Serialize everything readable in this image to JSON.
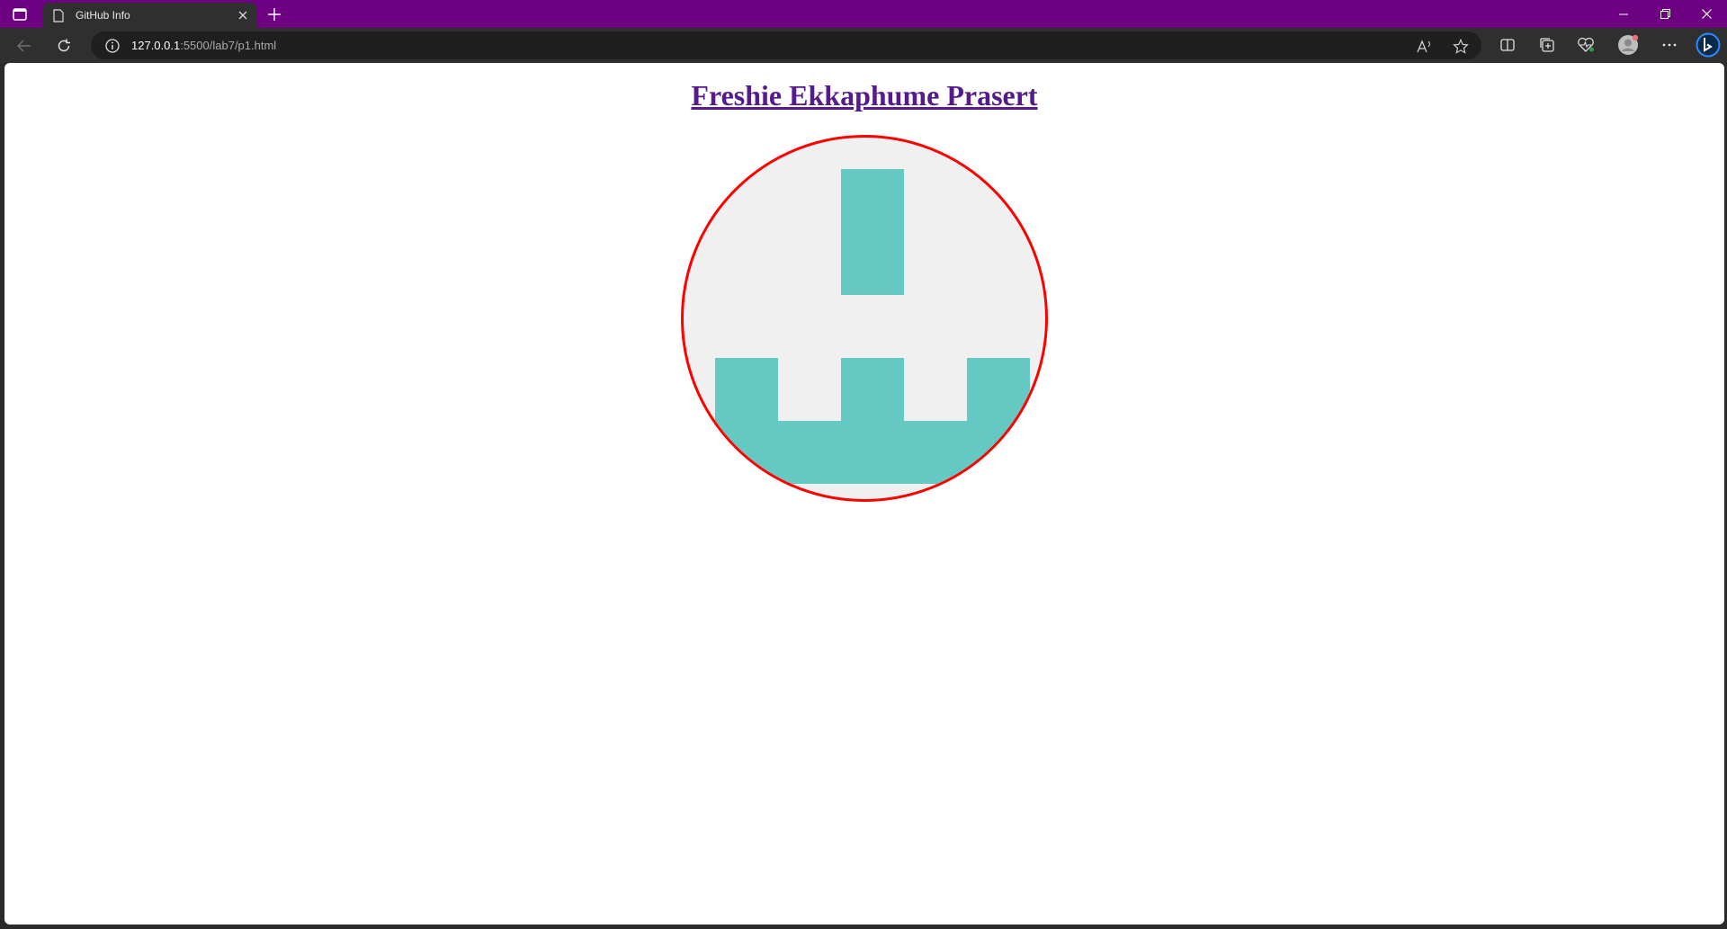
{
  "browser": {
    "tab": {
      "title": "GitHub Info"
    },
    "address": {
      "host": "127.0.0.1",
      "path": ":5500/lab7/p1.html"
    },
    "icons": [
      "tab-actions-icon",
      "page-icon",
      "close-icon",
      "plus-icon",
      "minimize-icon",
      "restore-icon",
      "close-window-icon",
      "back-icon",
      "refresh-icon",
      "info-icon",
      "read-aloud-icon",
      "favorite-star-icon",
      "split-screen-icon",
      "collections-icon",
      "browser-essentials-icon",
      "profile-avatar-icon",
      "more-icon",
      "bing-copilot-icon"
    ]
  },
  "page": {
    "heading": "Freshie Ekkaphume Prasert",
    "identicon": {
      "fill_color": "#66c8c3",
      "background": "#f0f0f0",
      "border_color": "#ff0000"
    }
  }
}
